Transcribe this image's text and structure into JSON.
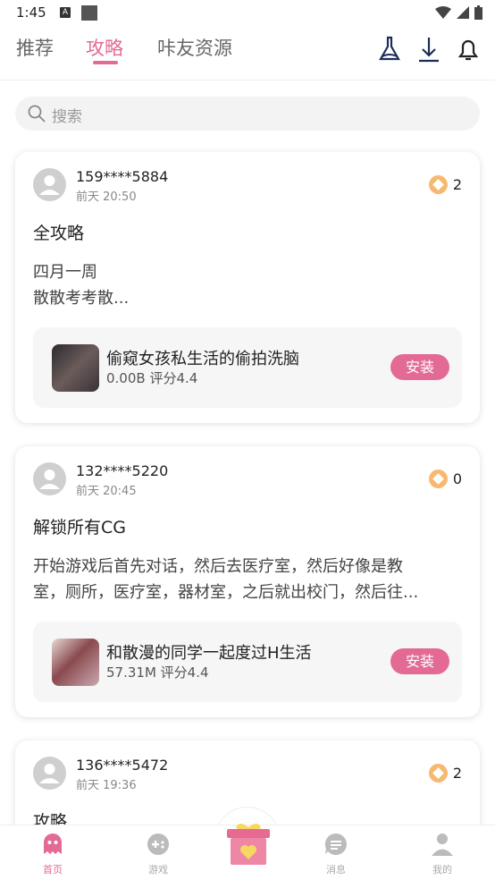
{
  "status": {
    "time": "1:45",
    "badge": "A"
  },
  "tabs": [
    {
      "label": "推荐"
    },
    {
      "label": "攻略"
    },
    {
      "label": "咔友资源"
    }
  ],
  "search": {
    "placeholder": "搜索"
  },
  "posts": [
    {
      "user": "159****5884",
      "time": "前天 20:50",
      "coins": "2",
      "title": "全攻略",
      "body": "四月一周\n散散考考散...",
      "game": {
        "name": "偷窥女孩私生活的偷拍洗脑",
        "meta": "0.00B  评分4.4",
        "install": "安装"
      }
    },
    {
      "user": "132****5220",
      "time": "前天 20:45",
      "coins": "0",
      "title": "解锁所有CG",
      "body": "开始游戏后首先对话，然后去医疗室，然后好像是教\n室，厕所，医疗室，器材室，之后就出校门，然后往...",
      "game": {
        "name": "和散漫的同学一起度过H生活",
        "meta": "57.31M  评分4.4",
        "install": "安装"
      }
    },
    {
      "user": "136****5472",
      "time": "前天 19:36",
      "coins": "2",
      "title": "攻略"
    }
  ],
  "nav": [
    {
      "label": "首页"
    },
    {
      "label": "游戏"
    },
    {
      "label": "消息"
    },
    {
      "label": "我的"
    }
  ],
  "colors": {
    "accent": "#e36a95",
    "coin": "#f7b870"
  }
}
